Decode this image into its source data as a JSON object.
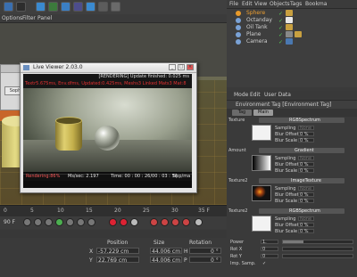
{
  "menu": {
    "items": [
      "Options",
      "Filter",
      "Panel"
    ]
  },
  "bg_window": {
    "button_label": "Soph"
  },
  "live_viewer": {
    "title": "Live Viewer 2.03.0",
    "status_top": "[RENDERING] Update finished: 0.025 ms",
    "status_red": "Textr5.675ms, Env.dfms, Updated:0.425ms, Meshs3 Linked Mats3 Mat:8",
    "bottom": {
      "rendering": "Rendering:86%",
      "ms_sec": "Ms/sec: 2.197",
      "time": "Time: 00 : 00 : 26/00 : 03 : 54",
      "spp": "Spp/ma"
    }
  },
  "timeline": {
    "ticks": [
      "0",
      "5",
      "10",
      "15",
      "20",
      "25",
      "30",
      "35 F"
    ]
  },
  "transport": {
    "frame": "90 F"
  },
  "coords": {
    "headers": [
      "Position",
      "Size",
      "Rotation"
    ],
    "rows": [
      {
        "axis": "X",
        "position": "-57.229 cm",
        "size": "44.006 cm",
        "rot_axis": "H",
        "rotation": "0 °"
      },
      {
        "axis": "Y",
        "position": "22.769 cm",
        "size": "44.006 cm",
        "rot_axis": "P",
        "rotation": "0 °"
      }
    ]
  },
  "om": {
    "menu": [
      "File",
      "Edit",
      "View",
      "Objects",
      "Tags",
      "Bookma"
    ],
    "objects": [
      {
        "name": "Sphere",
        "color": "#e89a2a"
      },
      {
        "name": "Octanday",
        "color": "#8fb4e8"
      },
      {
        "name": "Oil Tank",
        "color": "#8fb4e8"
      },
      {
        "name": "Plane",
        "color": "#8fb4e8"
      },
      {
        "name": "Camera",
        "color": "#8fb4e8"
      }
    ],
    "checks": [
      "✓",
      "✓",
      "✓",
      "✓",
      "✓"
    ]
  },
  "am": {
    "menu": [
      "Mode",
      "Edit",
      "User Data"
    ],
    "title": "Environment Tag [Environment Tag]",
    "tabs": [
      "Tag",
      "Main"
    ],
    "channels": [
      {
        "label": "Texture",
        "node": "RGBSpectrum",
        "sampling": "None",
        "blur_offset": "0 %",
        "blur_scale": "0 %"
      },
      {
        "label": "Amount",
        "node": "Gradient",
        "sampling": "None",
        "blur_offset": "0 %",
        "blur_scale": "0 %"
      },
      {
        "label": "Texture2",
        "node": "ImageTexture",
        "sampling": "None",
        "blur_offset": "0 %",
        "blur_scale": "0 %"
      },
      {
        "label": "Texture2",
        "node": "RGBSpectrum",
        "sampling": "None",
        "blur_offset": "0 %",
        "blur_scale": "0 %"
      }
    ],
    "sub_labels": {
      "sampling": "Sampling",
      "blur_offset": "Blur Offset",
      "blur_scale": "Blur Scale"
    },
    "bottom_params": [
      {
        "label": "Power",
        "value": "1."
      },
      {
        "label": "Rot X",
        "value": "0"
      },
      {
        "label": "Rot Y",
        "value": "0"
      },
      {
        "label": "Imp. Samp.",
        "value": "✓"
      }
    ]
  }
}
